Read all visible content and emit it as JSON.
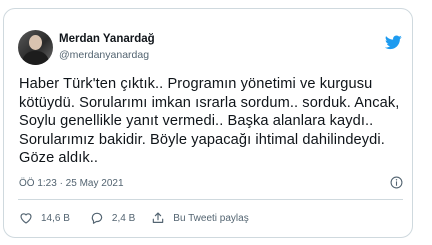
{
  "tweet": {
    "author_name": "Merdan Yanardağ",
    "author_handle": "@merdanyanardag",
    "text": "Haber Türk'ten çıktık.. Programın yönetimi ve kurgusu kötüydü. Sorularımı imkan ısrarla sordum.. sorduk. Ancak, Soylu genellikle yanıt vermedi.. Başka alanlara kaydı.. Sorularımız bakidir. Böyle yapacağı ihtimal dahilindeydi. Göze aldık..",
    "timestamp": "ÖÖ 1:23 · 25 May 2021",
    "like_count": "14,6 B",
    "reply_count": "2,4 B",
    "share_label": "Bu Tweeti paylaş"
  },
  "icons": {
    "brand": "twitter-bird-icon",
    "info": "info-icon",
    "like": "heart-icon",
    "reply": "reply-bubble-icon",
    "share": "share-icon"
  },
  "colors": {
    "brand_blue": "#1d9bf0",
    "text_primary": "#0f1419",
    "text_secondary": "#536471",
    "border": "#cfd9de"
  }
}
